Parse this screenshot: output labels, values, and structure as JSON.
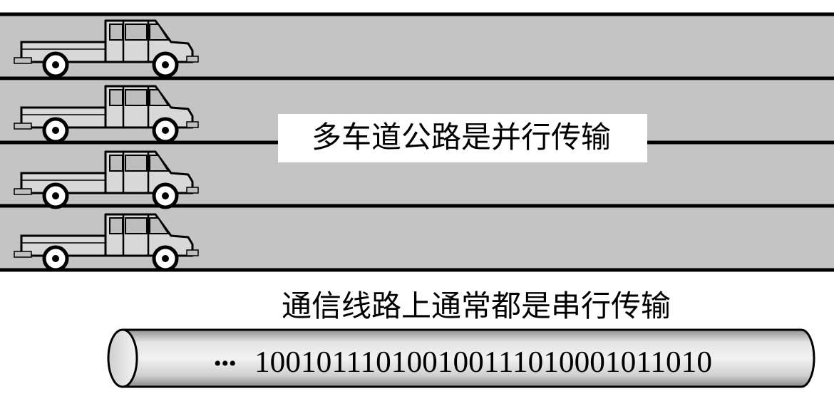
{
  "highway": {
    "lane_count": 4,
    "label": "多车道公路是并行传输",
    "colors": {
      "road": "#c4c4c4",
      "line": "#000000",
      "label_bg": "#ffffff"
    }
  },
  "serial": {
    "title": "通信线路上通常都是串行传输",
    "ellipsis": "•••",
    "bits": "10010111010010011101000101101­0",
    "colors": {
      "pipe_mid": "#e2e2e2",
      "pipe_edge": "#9a9a9a",
      "outline": "#000000"
    }
  }
}
